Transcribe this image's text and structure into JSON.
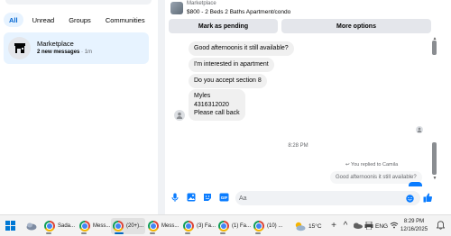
{
  "filters": [
    {
      "label": "All",
      "active": true
    },
    {
      "label": "Unread",
      "active": false
    },
    {
      "label": "Groups",
      "active": false
    },
    {
      "label": "Communities",
      "active": false
    }
  ],
  "thread": {
    "name": "Marketplace",
    "messages_bold": "2 new messages",
    "time": "· 1m"
  },
  "listing": {
    "category": "Marketplace",
    "title": "$800 - 2 Beds 2 Baths Apartment/condo"
  },
  "actions": {
    "pending_label": "Mark as pending",
    "more_label": "More options"
  },
  "messages": [
    "Good afternoonis it still available?",
    "I'm interested in apartment",
    "Do you accept section 8",
    "Myles\n4316312020\nPlease call back"
  ],
  "timestamp": "8:28 PM",
  "reply_note": "You replied to Camila",
  "reply_quote": "Good afternoonis it still available?",
  "composer": {
    "placeholder": "Aa"
  },
  "taskbar": {
    "apps": [
      {
        "label": "Sada..."
      },
      {
        "label": "Mess..."
      },
      {
        "label": "(20+)..."
      },
      {
        "label": "Mess..."
      },
      {
        "label": "(3) Fa..."
      },
      {
        "label": "(1) Fa..."
      },
      {
        "label": "(10) ..."
      }
    ],
    "weather": "15°C",
    "language": "ENG",
    "time": "8:29 PM",
    "date": "12/16/2025"
  },
  "colors": {
    "accent": "#0064d1",
    "selected_bg": "#e7f3ff",
    "bubble_bg": "#f0f0f0",
    "messenger_blue": "#0a7cff"
  }
}
